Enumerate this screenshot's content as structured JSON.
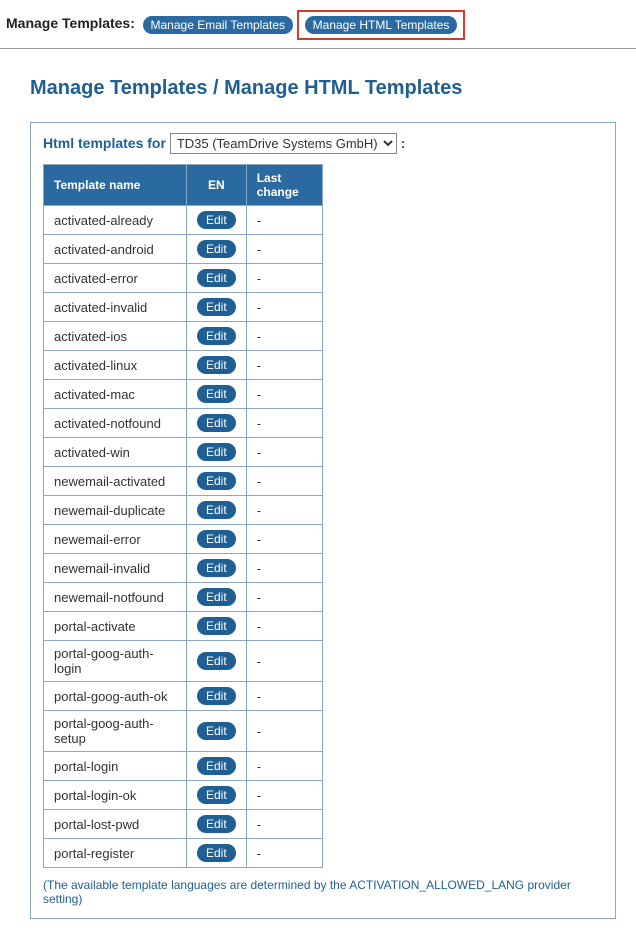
{
  "topbar": {
    "label": "Manage Templates:",
    "buttons": [
      {
        "label": "Manage Email Templates",
        "highlighted": false
      },
      {
        "label": "Manage HTML Templates",
        "highlighted": true
      }
    ]
  },
  "page_title": "Manage Templates / Manage HTML Templates",
  "panel": {
    "header_prefix": "Html templates for",
    "header_suffix": ":",
    "selected_option": "TD35 (TeamDrive Systems GmbH)",
    "columns": {
      "name": "Template name",
      "en": "EN",
      "last_change": "Last change"
    },
    "edit_label": "Edit",
    "rows": [
      {
        "name": "activated-already",
        "last_change": "-"
      },
      {
        "name": "activated-android",
        "last_change": "-"
      },
      {
        "name": "activated-error",
        "last_change": "-"
      },
      {
        "name": "activated-invalid",
        "last_change": "-"
      },
      {
        "name": "activated-ios",
        "last_change": "-"
      },
      {
        "name": "activated-linux",
        "last_change": "-"
      },
      {
        "name": "activated-mac",
        "last_change": "-"
      },
      {
        "name": "activated-notfound",
        "last_change": "-"
      },
      {
        "name": "activated-win",
        "last_change": "-"
      },
      {
        "name": "newemail-activated",
        "last_change": "-"
      },
      {
        "name": "newemail-duplicate",
        "last_change": "-"
      },
      {
        "name": "newemail-error",
        "last_change": "-"
      },
      {
        "name": "newemail-invalid",
        "last_change": "-"
      },
      {
        "name": "newemail-notfound",
        "last_change": "-"
      },
      {
        "name": "portal-activate",
        "last_change": "-"
      },
      {
        "name": "portal-goog-auth-login",
        "last_change": "-"
      },
      {
        "name": "portal-goog-auth-ok",
        "last_change": "-"
      },
      {
        "name": "portal-goog-auth-setup",
        "last_change": "-"
      },
      {
        "name": "portal-login",
        "last_change": "-"
      },
      {
        "name": "portal-login-ok",
        "last_change": "-"
      },
      {
        "name": "portal-lost-pwd",
        "last_change": "-"
      },
      {
        "name": "portal-register",
        "last_change": "-"
      }
    ],
    "footnote": "(The available template languages are determined by the ACTIVATION_ALLOWED_LANG provider setting)"
  }
}
